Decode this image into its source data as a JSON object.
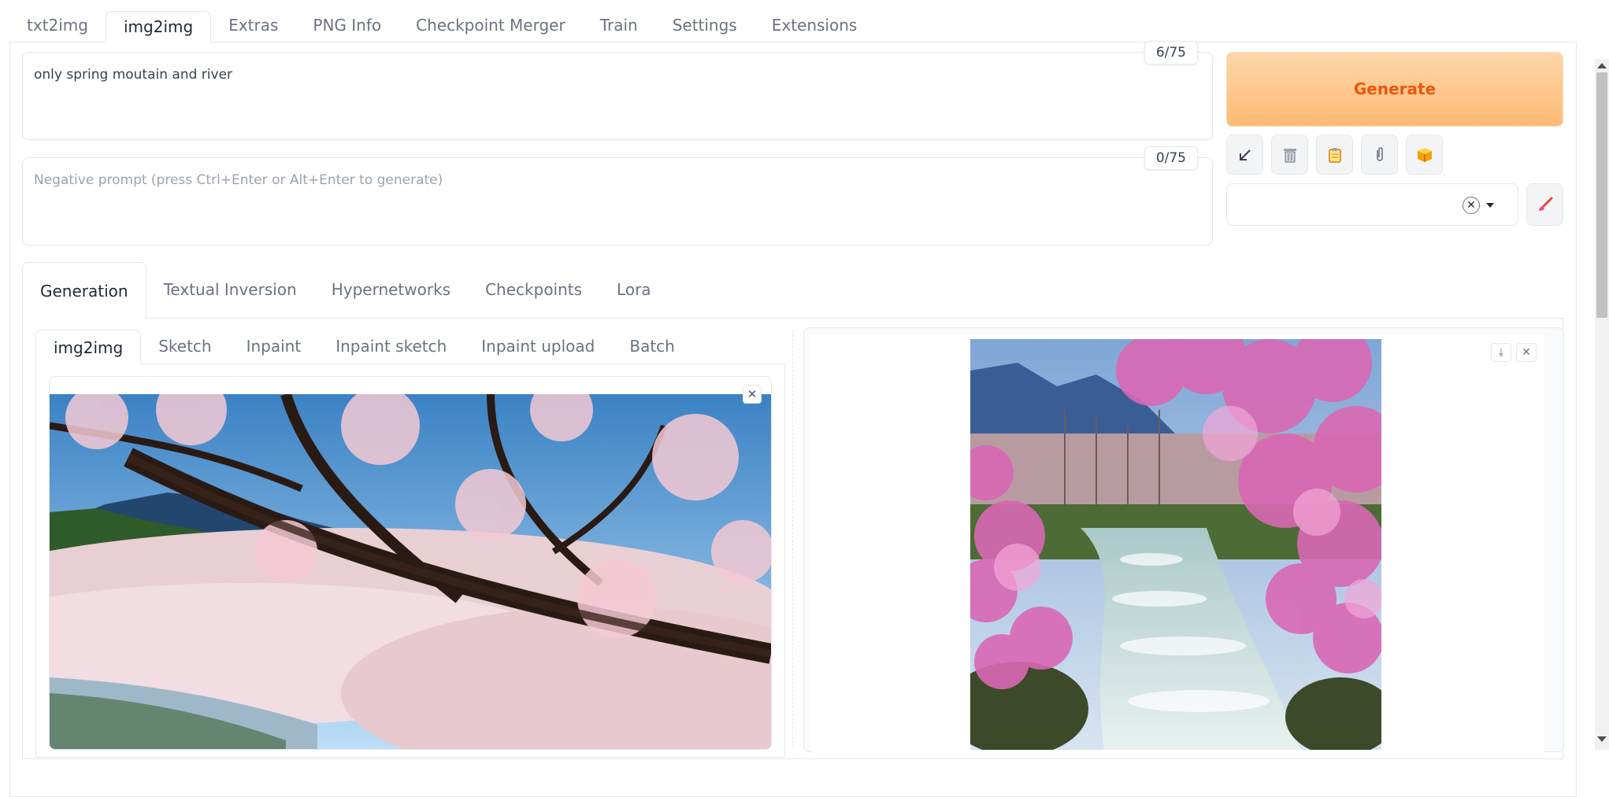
{
  "top_tabs": [
    "txt2img",
    "img2img",
    "Extras",
    "PNG Info",
    "Checkpoint Merger",
    "Train",
    "Settings",
    "Extensions"
  ],
  "prompt": {
    "value": "only spring moutain and river",
    "counter": "6/75"
  },
  "negative_prompt": {
    "placeholder": "Negative prompt (press Ctrl+Enter or Alt+Enter to generate)",
    "counter": "0/75"
  },
  "generate_label": "Generate",
  "tools": [
    "arrow-icon",
    "trash-icon",
    "clipboard-icon",
    "paperclip-icon",
    "package-icon"
  ],
  "style_select": {
    "value": "",
    "clear": "✕"
  },
  "main_tabs": [
    "Generation",
    "Textual Inversion",
    "Hypernetworks",
    "Checkpoints",
    "Lora"
  ],
  "sub_tabs": [
    "img2img",
    "Sketch",
    "Inpaint",
    "Inpaint sketch",
    "Inpaint upload",
    "Batch"
  ],
  "colors": {
    "accent": "#ea580c",
    "generate_from": "#fed7aa",
    "generate_to": "#fdba74"
  }
}
